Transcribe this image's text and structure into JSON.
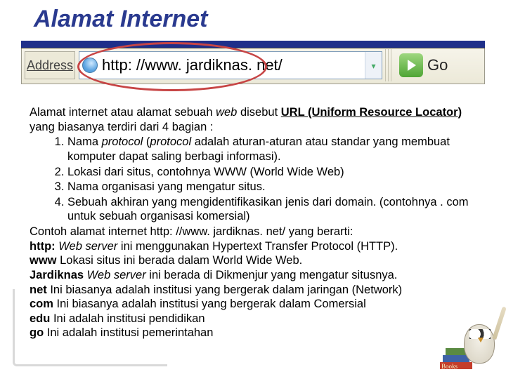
{
  "title": "Alamat Internet",
  "address_bar": {
    "address_label": "Address",
    "url": "http: //www. jardiknas. net/",
    "go_label": "Go",
    "dropdown_glyph": "▾"
  },
  "intro": {
    "pre": "Alamat internet atau alamat sebuah ",
    "web": "web",
    "mid": " disebut ",
    "url_term": "URL (Uniform Resource Locator",
    "close_paren": ")",
    "tail": " yang biasanya terdiri dari 4 bagian :"
  },
  "list": [
    {
      "pre": "Nama ",
      "i1": "protocol",
      "mid1": " (",
      "i2": "protocol",
      "mid2": " adalah aturan-aturan atau standar yang membuat komputer dapat saling berbagi informasi)."
    },
    {
      "text": "Lokasi dari situs, contohnya WWW (World Wide Web)"
    },
    {
      "text": "Nama organisasi yang mengatur situs."
    },
    {
      "text": "Sebuah akhiran yang mengidentifikasikan jenis dari domain. (contohnya . com untuk sebuah organisasi komersial)"
    }
  ],
  "example_intro": "Contoh alamat internet http: //www. jardiknas. net/ yang berarti:",
  "defs": [
    {
      "term": "http:",
      "sep": " ",
      "i": "Web server",
      "tail": " ini menggunakan Hypertext Transfer Protocol (HTTP)."
    },
    {
      "term": "www",
      "sep": " ",
      "i": "",
      "tail": "Lokasi situs ini berada dalam World Wide Web."
    },
    {
      "term": "Jardiknas",
      "sep": "  ",
      "i": "Web server",
      "tail": " ini berada di Dikmenjur yang mengatur situsnya."
    },
    {
      "term": "net",
      "sep": " ",
      "i": "",
      "tail": "Ini biasanya adalah institusi yang bergerak dalam jaringan (Network)"
    },
    {
      "term": "com",
      "sep": " ",
      "i": "",
      "tail": "Ini biasanya adalah institusi yang bergerak dalam Comersial"
    },
    {
      "term": "edu",
      "sep": " ",
      "i": "",
      "tail": "Ini adalah institusi pendidikan"
    },
    {
      "term": "go",
      "sep": " ",
      "i": "",
      "tail": "Ini  adalah institusi pemerintahan"
    }
  ]
}
